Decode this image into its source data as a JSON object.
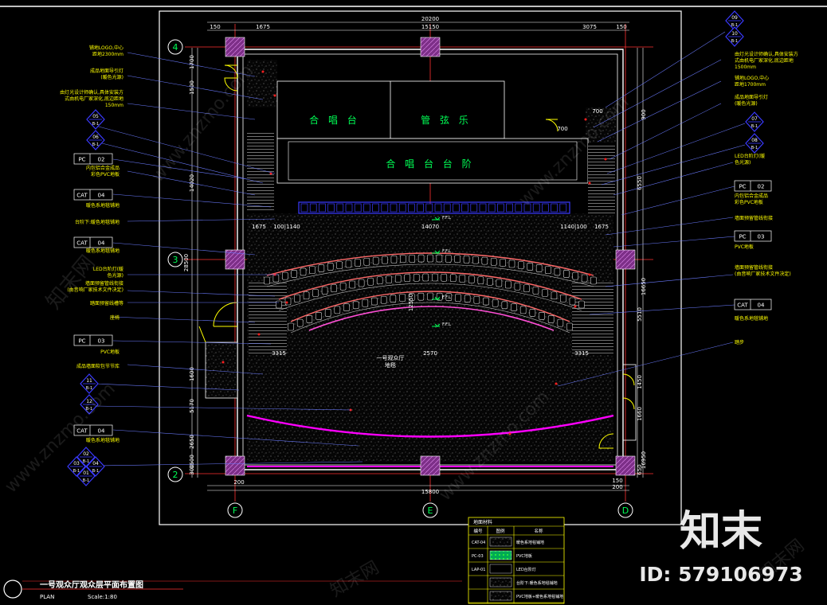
{
  "drawing": {
    "title": "一号观众厅观众层平面布置图",
    "subtitle": "PLAN",
    "scale": "Scale:1:80"
  },
  "axes": {
    "row_top": "4",
    "row_mid": "3",
    "row_bottom": "2",
    "col_left": "F",
    "col_mid": "E",
    "col_right": "D"
  },
  "dimensions": {
    "top_total": "20200",
    "top_segments": [
      "150",
      "1675",
      "15150",
      "3075",
      "150"
    ],
    "bottom_total": "15800",
    "bottom_segments": [
      "200",
      "150",
      "200"
    ],
    "mid_total": "14070",
    "mid_segments": [
      "1675",
      "100|1140",
      "1140|100",
      "1675"
    ],
    "lower_left": "3315",
    "lower_mid": "2570",
    "lower_right": "3315",
    "left_vertical": [
      "1700",
      "1500",
      "14020",
      "28500",
      "1600",
      "5170",
      "2650",
      "1500",
      "300"
    ],
    "right_vertical": [
      "900",
      "6550",
      "16650",
      "5510",
      "1450",
      "1660",
      "16950",
      "650"
    ],
    "center_vertical": "12550",
    "inner_small": [
      "700",
      "700"
    ]
  },
  "rooms": {
    "chorus": "合 唱 台",
    "orchestra": "管 弦 乐",
    "platform": "合 唱 台 台 阶",
    "hall": "一号观众厅",
    "hall_sub": "地毯"
  },
  "level_marks": [
    "F.F.L",
    "F.F.L",
    "F.F.L",
    "F.F.L"
  ],
  "left_notes": [
    "铺地LOGO,中心\n距地2300mm",
    "成品地面导引灯\n(暖色光源)",
    "由灯光设计师确认,具体安装方\n式由机电厂家深化,底边距地\n150mm",
    "内包铝合金成品\n彩色PVC地板",
    "暖色系地毯铺地",
    "台阶下:暖色地毯铺地",
    "暖色系地毯铺地",
    "LED台阶灯(暖\n色光源)",
    "墙面预留管线衔接\n(由音响厂家技术文件决定)",
    "踏面预留线槽等",
    "座椅",
    "PVC地板",
    "成品墙面软包节节库",
    "暖色系地毯铺地"
  ],
  "right_notes": [
    "由灯光设计师确认,具体安装方\n式由机电厂家深化,底边距地\n1500mm",
    "铺地LOGO,中心\n距地1700mm",
    "成品地面导引灯\n(暖色光源)",
    "LED台阶灯(暖\n色光源)",
    "内包铝合金成品\n彩色PVC地板",
    "墙面预留管线衔接",
    "PVC地板",
    "墙面预留管线衔接\n(由音响厂家技术文件决定)",
    "暖色系地毯铺地",
    "踏步"
  ],
  "tags": {
    "pc02": [
      "PC",
      "02"
    ],
    "cat04": [
      "CAT",
      "04"
    ],
    "pc03": [
      "PC",
      "03"
    ]
  },
  "symbols": {
    "s05": [
      "05",
      "B-1"
    ],
    "s06": [
      "06",
      "B-1"
    ],
    "s09": [
      "09",
      "B-1"
    ],
    "s10": [
      "10",
      "B-1"
    ],
    "s07": [
      "07",
      "B-1"
    ],
    "s08": [
      "08",
      "B-1"
    ],
    "s11": [
      "11",
      "B-1"
    ],
    "s12": [
      "12",
      "B-1"
    ],
    "s02": [
      "02",
      "B-1"
    ],
    "s03": [
      "03",
      "B-1"
    ],
    "s04": [
      "04",
      "B-1"
    ],
    "s01": [
      "01",
      "B-1"
    ]
  },
  "legend": {
    "title": "地面材料",
    "headers": [
      "编号",
      "图例",
      "名称"
    ],
    "rows": [
      [
        "CAT-04",
        "",
        "暖色系地毯铺地"
      ],
      [
        "PC-03",
        "",
        "PVC地板"
      ],
      [
        "LAP-01",
        "",
        "LED台阶灯"
      ],
      [
        "",
        "",
        "台阶下:暖色系地毯铺地"
      ],
      [
        "",
        "",
        "PVC地板+暖色系地毯铺地"
      ]
    ]
  },
  "watermark": {
    "brand": "知末",
    "id_label": "ID: 579106973",
    "site": "www.znzmo.com",
    "site_cn": "知末网"
  },
  "colors": {
    "bg": "#000000",
    "wall": "#ffffff",
    "axis": "#ff3030",
    "dim": "#ffffff",
    "column": "#b94fc0",
    "magenta": "#ff00ff",
    "yellow": "#ffff00",
    "blue": "#3a3aff",
    "green": "#00ff55",
    "cyan": "#00ffff"
  }
}
